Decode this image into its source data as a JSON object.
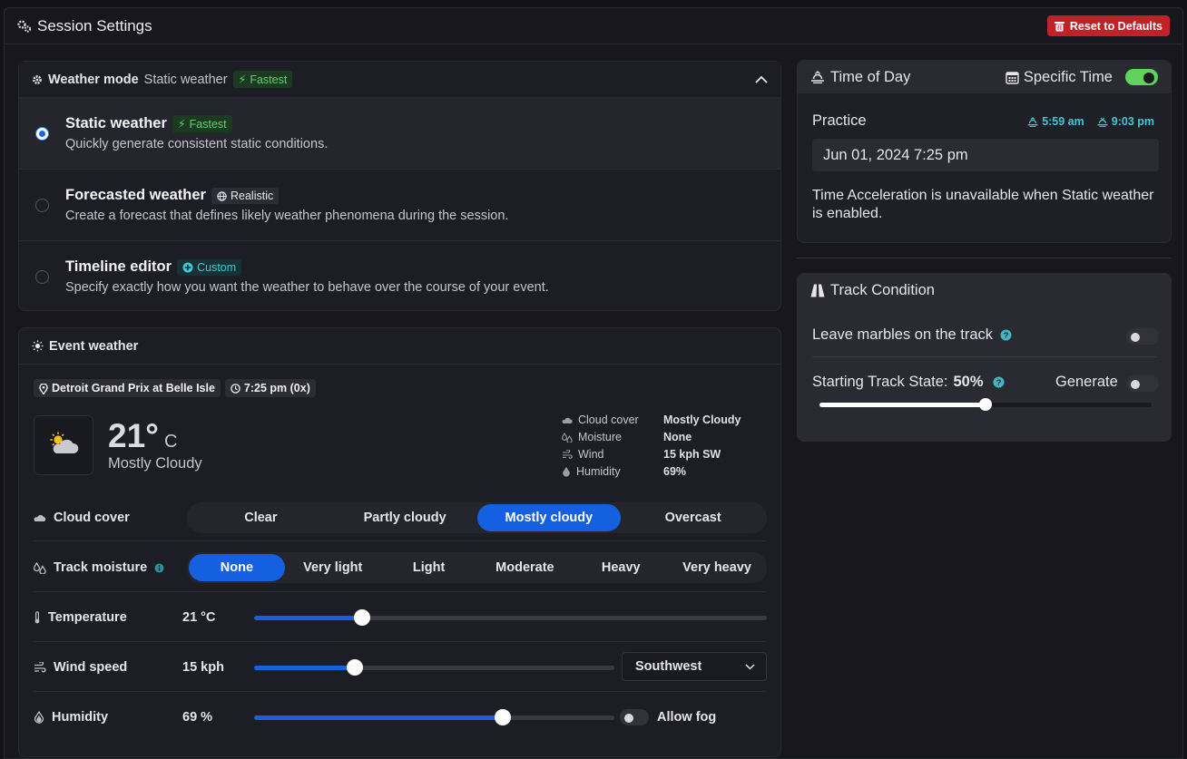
{
  "window": {
    "title": "Session Settings",
    "reset_label": "Reset to Defaults"
  },
  "weather_mode": {
    "label": "Weather mode",
    "current": "Static weather",
    "current_badge": "Fastest",
    "options": [
      {
        "title": "Static weather",
        "badge": "Fastest",
        "description": "Quickly generate consistent static conditions.",
        "selected": true
      },
      {
        "title": "Forecasted weather",
        "badge": "Realistic",
        "description": "Create a forecast that defines likely weather phenomena during the session.",
        "selected": false
      },
      {
        "title": "Timeline editor",
        "badge": "Custom",
        "description": "Specify exactly how you want the weather to behave over the course of your event.",
        "selected": false
      }
    ]
  },
  "event_weather": {
    "label": "Event weather",
    "location": "Detroit Grand Prix at Belle Isle",
    "time": "7:25 pm (0x)",
    "temp_value": "21°",
    "temp_unit": "C",
    "condition": "Mostly Cloudy",
    "stats": [
      {
        "key": "Cloud cover",
        "value": "Mostly Cloudy",
        "icon": "cloud-icon"
      },
      {
        "key": "Moisture",
        "value": "None",
        "icon": "droplets-icon"
      },
      {
        "key": "Wind",
        "value": "15 kph SW",
        "icon": "wind-icon"
      },
      {
        "key": "Humidity",
        "value": "69%",
        "icon": "humidity-icon"
      }
    ],
    "cloud_cover": {
      "label": "Cloud cover",
      "options": [
        "Clear",
        "Partly cloudy",
        "Mostly cloudy",
        "Overcast"
      ],
      "selected": "Mostly cloudy"
    },
    "track_moisture": {
      "label": "Track moisture",
      "options": [
        "None",
        "Very light",
        "Light",
        "Moderate",
        "Heavy",
        "Very heavy"
      ],
      "selected": "None"
    },
    "temperature": {
      "label": "Temperature",
      "value": "21 °C",
      "level": 0.21
    },
    "wind_speed": {
      "label": "Wind speed",
      "value": "15 kph",
      "level": 0.28,
      "direction": "Southwest"
    },
    "humidity": {
      "label": "Humidity",
      "value": "69 %",
      "level": 0.69,
      "fog_label": "Allow fog",
      "fog_enabled": false
    }
  },
  "time_of_day": {
    "label": "Time of Day",
    "specific_time_label": "Specific Time",
    "specific_time_enabled": true,
    "session": "Practice",
    "sunrise": "5:59 am",
    "sunset": "9:03 pm",
    "datetime": "Jun 01, 2024 7:25 pm",
    "note": "Time Acceleration is unavailable when Static weather is enabled."
  },
  "track_condition": {
    "label": "Track Condition",
    "marbles_label": "Leave marbles on the track",
    "marbles_enabled": false,
    "state_label": "Starting Track State:",
    "state_value": "50%",
    "state_level": 0.5,
    "generate_label": "Generate",
    "generate_enabled": false
  },
  "colors": {
    "accent": "#1560e0",
    "danger": "#c0222a",
    "success": "#5fd45c",
    "teal": "#43c7d0"
  }
}
